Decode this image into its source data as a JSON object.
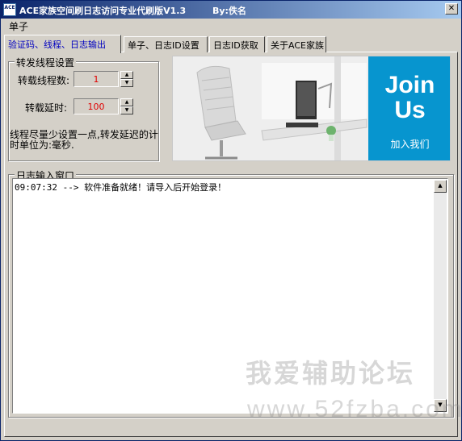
{
  "window": {
    "title": "ACE家族空间刷日志访问专业代刷版V1.3",
    "author": "By:佚名",
    "icon_text": "ACE",
    "close_label": "✕"
  },
  "menu": {
    "items": [
      {
        "label": "单子"
      }
    ]
  },
  "tabs": [
    {
      "label": "验证码、线程、日志输出",
      "active": true
    },
    {
      "label": "单子、日志ID设置",
      "active": false
    },
    {
      "label": "日志ID获取",
      "active": false
    },
    {
      "label": "关于ACE家族",
      "active": false
    }
  ],
  "thread_settings": {
    "title": "转发线程设置",
    "thread_count_label": "转载线程数:",
    "thread_count_value": "1",
    "delay_label": "转载延时:",
    "delay_value": "100",
    "hint": "线程尽量少设置一点,转发延迟的计时单位为:毫秒."
  },
  "banner": {
    "join_line1": "Join",
    "join_line2": "Us",
    "join_cn": "加入我们"
  },
  "log": {
    "title": "日志输入窗口",
    "lines": [
      "09:07:32 --> 软件准备就绪！请导入后开始登录！"
    ]
  },
  "watermark": {
    "line1": "我爱辅助论坛",
    "line2": "www.52fzba.com"
  },
  "colors": {
    "titlebar_start": "#0a246a",
    "titlebar_end": "#a6caf0",
    "face": "#d4d0c8",
    "active_tab_text": "#0000c0",
    "input_value_text": "#e00000",
    "banner_blue": "#0795cf"
  }
}
